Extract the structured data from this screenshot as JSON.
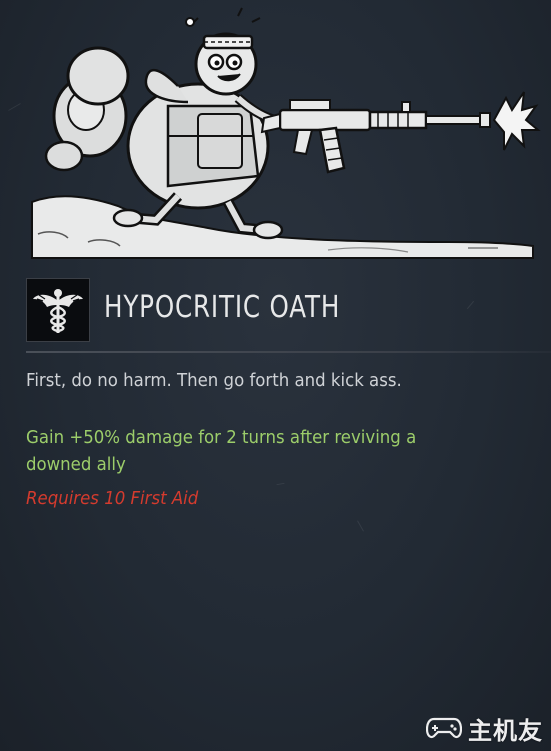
{
  "perk": {
    "title": "HYPOCRITIC OATH",
    "flavor_text": "First, do no harm. Then go forth and kick ass.",
    "effect_line_1": "Gain +50% damage for 2 turns after reviving a",
    "effect_line_2": "downed ally",
    "requirement": "Requires 10 First Aid"
  },
  "watermark": {
    "text": "主机友",
    "icon": "gamepad-icon"
  },
  "illustration": {
    "icon": "armored-medic-with-rifle-illustration"
  },
  "perk_icon": {
    "icon": "caduceus-icon"
  },
  "colors": {
    "background": "#222a34",
    "title": "#e7e8e9",
    "flavor": "#cfd2d6",
    "effect": "#9ccd6a",
    "requirement": "#d43b2e"
  }
}
